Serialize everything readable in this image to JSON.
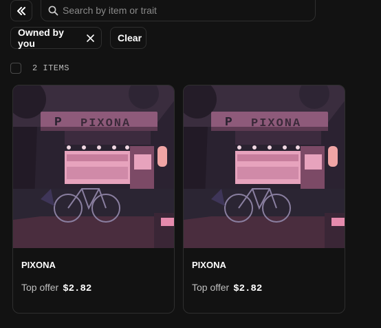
{
  "search": {
    "placeholder": "Search by item or trait"
  },
  "filters": {
    "owned_label": "Owned by you",
    "clear_label": "Clear"
  },
  "list": {
    "count_label": "2 ITEMS"
  },
  "items": [
    {
      "name": "PIXONA",
      "sign_text": "PIXONA",
      "offer_label": "Top offer",
      "offer_price": "$2.82"
    },
    {
      "name": "PIXONA",
      "sign_text": "PIXONA",
      "offer_label": "Top offer",
      "offer_price": "$2.82"
    }
  ],
  "icons": {
    "collapse": "double-chevron-left-icon",
    "search": "search-icon",
    "remove_filter": "close-icon"
  },
  "colors": {
    "background": "#121212",
    "border": "#2f2f2f",
    "art_sign": "#e07a9a",
    "art_night": "#2a2230"
  }
}
